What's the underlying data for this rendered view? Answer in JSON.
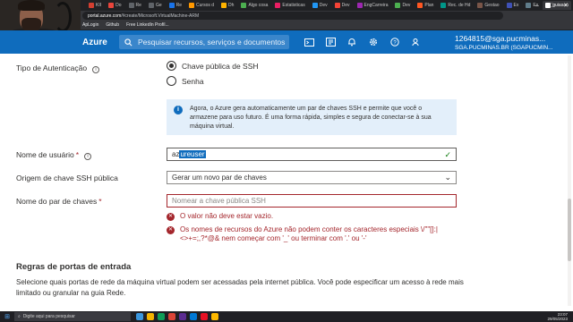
{
  "browser": {
    "tabs": [
      {
        "label": "KII",
        "color": "#d23f31"
      },
      {
        "label": "Do",
        "color": "#e8453c"
      },
      {
        "label": "Re",
        "color": "#5f6368"
      },
      {
        "label": "Ge",
        "color": "#5f6368"
      },
      {
        "label": "Re",
        "color": "#1a73e8"
      },
      {
        "label": "Cursos d",
        "color": "#ff9800"
      },
      {
        "label": "Dh",
        "color": "#ffb300"
      },
      {
        "label": "Algo cosa",
        "color": "#4caf50"
      },
      {
        "label": "Estatisticas",
        "color": "#e91e63"
      },
      {
        "label": "Dev",
        "color": "#2196f3"
      },
      {
        "label": "Dev",
        "color": "#f44336"
      },
      {
        "label": "EngCarreira",
        "color": "#9c27b0"
      },
      {
        "label": "Dev",
        "color": "#4caf50"
      },
      {
        "label": "Plan",
        "color": "#ff5722"
      },
      {
        "label": "Rec. de Hd",
        "color": "#009688"
      },
      {
        "label": "Gestao",
        "color": "#795548"
      },
      {
        "label": "Ex",
        "color": "#3f51b5"
      },
      {
        "label": "Ex",
        "color": "#607d8b"
      },
      {
        "label": "guiasan",
        "color": "#ffffff"
      }
    ],
    "address_host": "portal.azure.com",
    "address_path": "/#create/Microsoft.VirtualMachine-ARM",
    "bookmarks": [
      "ApLogin",
      "Github",
      "Free LinkedIn Profil..."
    ]
  },
  "azure": {
    "brand": "Azure",
    "search_placeholder": "Pesquisar recursos, serviços e documentos",
    "account_line1": "1264815@sga.pucminas...",
    "account_line2": "SGA.PUCMINAS.BR (SGAPUCMIN..."
  },
  "form": {
    "auth_label": "Tipo de Autenticação",
    "auth_option_ssh": "Chave pública de SSH",
    "auth_option_password": "Senha",
    "info_text": "Agora, o Azure gera automaticamente um par de chaves SSH e permite que você o armazene para uso futuro. É uma forma rápida, simples e segura de conectar-se à sua máquina virtual.",
    "username_label": "Nome de usuário",
    "username_prefix": "az",
    "username_selected": "ureuser",
    "ssh_source_label": "Origem de chave SSH pública",
    "ssh_source_value": "Gerar um novo par de chaves",
    "keypair_label": "Nome do par de chaves",
    "keypair_placeholder": "Nomear a chave pública SSH",
    "error_empty": "O valor não deve estar vazio.",
    "error_chars": "Os nomes de recursos do Azure não podem conter os caracteres especiais \\/\"\"[]:|<>+=;,?*@& nem começar com '_' ou terminar com '.' ou '-'",
    "ports_title": "Regras de portas de entrada",
    "ports_text": "Selecione quais portas de rede da máquina virtual podem ser acessadas pela internet pública. Você pode especificar um acesso à rede mais limitado ou granular na guia Rede."
  },
  "taskbar": {
    "search_placeholder": "Digite aqui para pesquisar",
    "time": "23:07",
    "date": "29/05/2023",
    "weather": "20°C",
    "app_colors": [
      "#3a96dd",
      "#f4b400",
      "#0f9d58",
      "#db4437",
      "#5c2d91",
      "#0078d4",
      "#e81123",
      "#ffb900"
    ]
  }
}
